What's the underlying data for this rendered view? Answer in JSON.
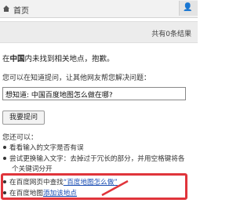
{
  "header": {
    "home_label": "首页",
    "user_icon_label": "👤"
  },
  "results": {
    "count_label": "共有0条结果"
  },
  "message": {
    "prefix": "在",
    "place": "中国",
    "suffix": "内未找到相关地点，抱歉。"
  },
  "ask": {
    "prompt": "您可以在知道提问，让其他网友帮您解决问题：",
    "input_value": "想知道: 中国百度地图怎么做在哪?",
    "button_label": "我要提问"
  },
  "tips": {
    "title": "您还可以：",
    "items": [
      "看看输入的文字是否有误",
      "尝试更换输入文字：去掉过于冗长的部分，并用空格键将各",
      "个关键词分开"
    ],
    "link_items": [
      {
        "prefix": "在百度网页中查找",
        "link": "“百度地图怎么做”"
      },
      {
        "prefix": "在百度地图",
        "link": "添加该地点"
      }
    ]
  },
  "colors": {
    "highlight": "#e0343b",
    "link": "#1a4db3"
  }
}
